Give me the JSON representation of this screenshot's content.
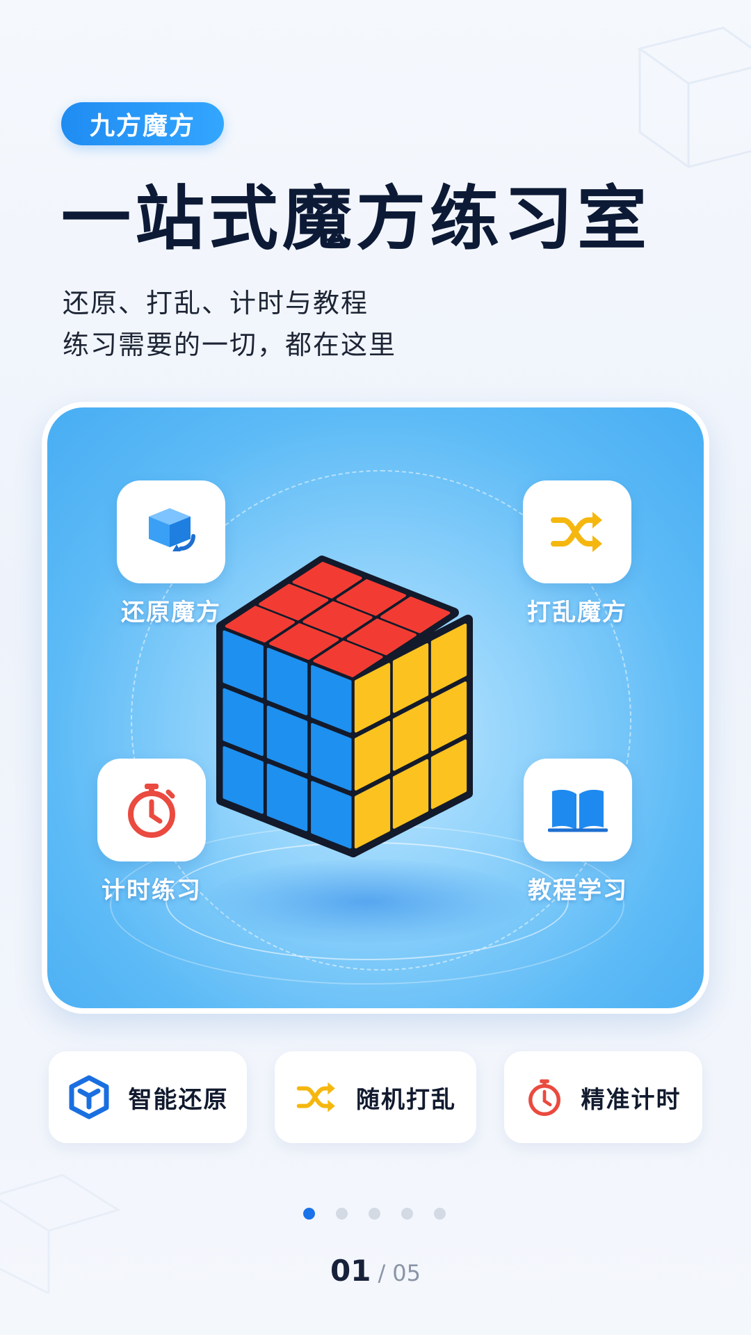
{
  "brand": {
    "label": "九方魔方"
  },
  "title": "一站式魔方练习室",
  "subtitle": {
    "line1": "还原、打乱、计时与教程",
    "line2": "练习需要的一切，都在这里"
  },
  "hero": {
    "cube_colors": {
      "top": "#f23c33",
      "front": "#1e90f0",
      "right": "#fcc21f",
      "frame": "#131a2b"
    },
    "features": [
      {
        "label": "还原魔方",
        "icon": "cube-restore-icon",
        "color": "#1e8af0"
      },
      {
        "label": "打乱魔方",
        "icon": "shuffle-icon",
        "color": "#f5b70f"
      },
      {
        "label": "计时练习",
        "icon": "stopwatch-icon",
        "color": "#ea4a3f"
      },
      {
        "label": "教程学习",
        "icon": "book-icon",
        "color": "#1e8af0"
      }
    ]
  },
  "actions": [
    {
      "label": "智能还原",
      "icon": "smart-cube-icon",
      "color": "#1a6fe0"
    },
    {
      "label": "随机打乱",
      "icon": "shuffle-icon",
      "color": "#f5b70f"
    },
    {
      "label": "精准计时",
      "icon": "stopwatch-icon",
      "color": "#ea4a3f"
    }
  ],
  "pagination": {
    "total_dots": 5,
    "active_index": 0
  },
  "page_indicator": {
    "current": "01",
    "separator": "/",
    "total": "05"
  },
  "colors": {
    "accent": "#1a73e8",
    "pill": "#1f8cf2"
  }
}
